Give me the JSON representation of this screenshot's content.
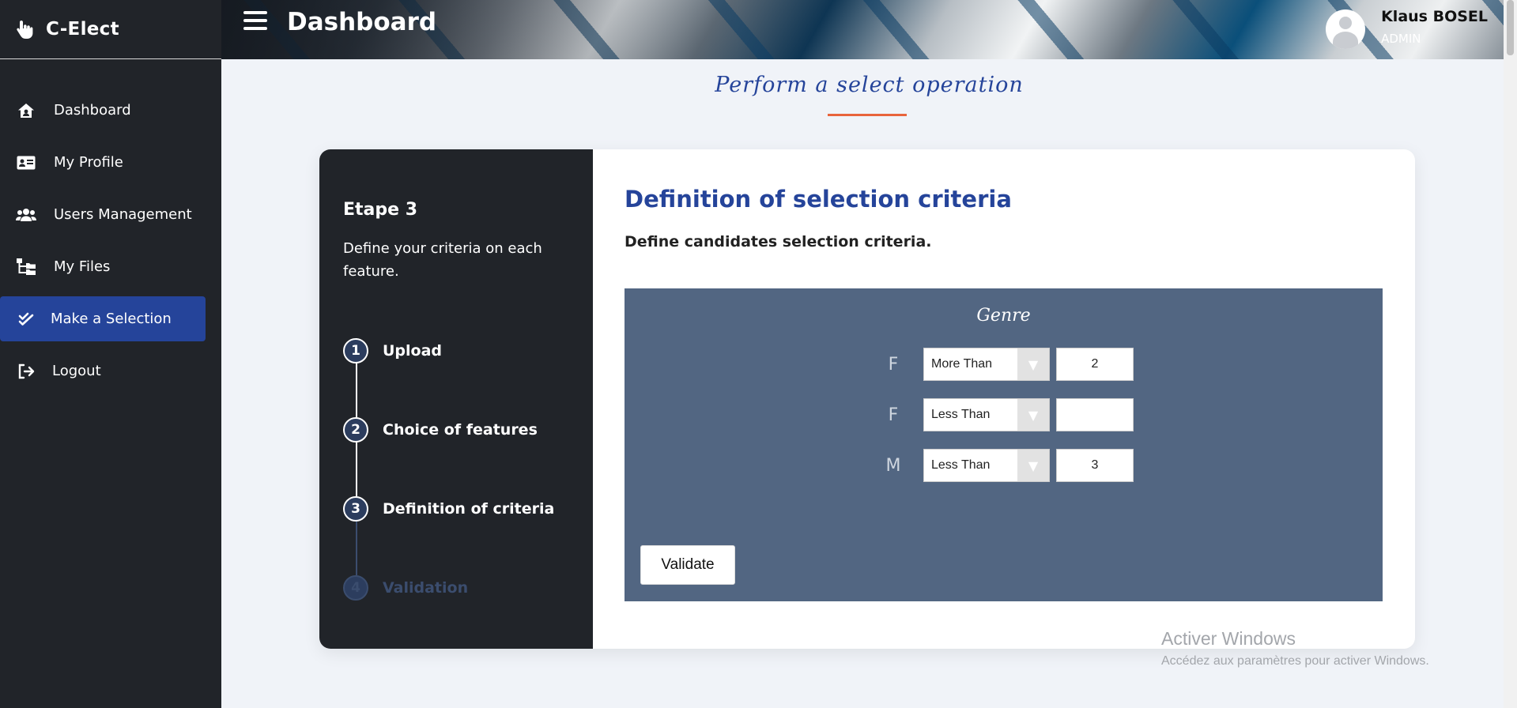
{
  "brand": {
    "name": "C-Elect"
  },
  "sidebar": {
    "items": [
      {
        "label": "Dashboard",
        "icon": "house-user-icon"
      },
      {
        "label": "My Profile",
        "icon": "id-card-icon"
      },
      {
        "label": "Users Management",
        "icon": "users-icon"
      },
      {
        "label": "My Files",
        "icon": "folder-tree-icon"
      },
      {
        "label": "Make a Selection",
        "icon": "check-double-icon",
        "active": true
      },
      {
        "label": "Logout",
        "icon": "sign-out-icon"
      }
    ]
  },
  "header": {
    "title": "Dashboard",
    "user": {
      "name": "Klaus BOSEL",
      "role": "ADMIN"
    }
  },
  "section": {
    "heading": "Perform a select operation"
  },
  "steps_panel": {
    "title": "Etape 3",
    "description": "Define your criteria on each feature.",
    "steps": [
      {
        "num": "1",
        "label": "Upload"
      },
      {
        "num": "2",
        "label": "Choice of features"
      },
      {
        "num": "3",
        "label": "Definition of criteria"
      },
      {
        "num": "4",
        "label": "Validation"
      }
    ]
  },
  "criteria": {
    "title": "Definition of selection criteria",
    "description": "Define candidates selection criteria.",
    "feature": "Genre",
    "rows": [
      {
        "label": "F",
        "operator": "More Than",
        "value": "2"
      },
      {
        "label": "F",
        "operator": "Less Than",
        "value": ""
      },
      {
        "label": "M",
        "operator": "Less Than",
        "value": "3"
      }
    ],
    "validate_label": "Validate"
  },
  "watermark": {
    "title": "Activer Windows",
    "subtitle": "Accédez aux paramètres pour activer Windows."
  },
  "colors": {
    "accent": "#25449a",
    "sidebar": "#212429",
    "criteria_bg": "#526682",
    "underline": "#e8643c"
  }
}
